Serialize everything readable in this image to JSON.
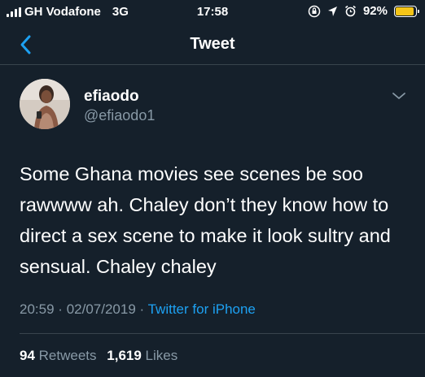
{
  "status_bar": {
    "carrier": "GH Vodafone",
    "network": "3G",
    "time": "17:58",
    "battery_percent": "92%",
    "battery_level": 0.92,
    "battery_color": "#f5c518"
  },
  "nav": {
    "back_icon": "chevron-left-icon",
    "title": "Tweet",
    "accent_color": "#1da1f2"
  },
  "tweet": {
    "display_name": "efiaodo",
    "handle": "@efiaodo1",
    "text": "Some Ghana movies see scenes be soo rawwww ah. Chaley don’t they know how to direct a sex scene to make it look sultry and sensual. Chaley chaley",
    "time": "20:59",
    "date": "02/07/2019",
    "separator": "·",
    "source": "Twitter for iPhone",
    "retweets_count": "94",
    "retweets_label": "Retweets",
    "likes_count": "1,619",
    "likes_label": "Likes"
  },
  "colors": {
    "background": "#15202b",
    "secondary_text": "#8899a6",
    "divider": "#38444d"
  }
}
